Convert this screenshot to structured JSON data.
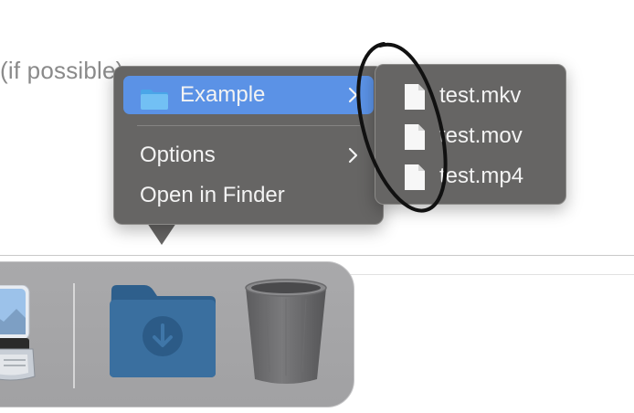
{
  "background": {
    "text": "(if possible)"
  },
  "context_menu": {
    "items": [
      {
        "label": "Example",
        "icon": "folder-icon",
        "has_submenu": true,
        "highlighted": true
      },
      {
        "label": "Options",
        "has_submenu": true
      },
      {
        "label": "Open in Finder"
      }
    ]
  },
  "submenu": {
    "items": [
      {
        "label": "test.mkv",
        "icon": "document-icon"
      },
      {
        "label": "test.mov",
        "icon": "document-icon"
      },
      {
        "label": "test.mp4",
        "icon": "document-icon"
      }
    ]
  },
  "dock": {
    "items": [
      {
        "icon": "preview-app-icon"
      },
      {
        "icon": "downloads-folder-icon"
      },
      {
        "icon": "trash-icon"
      }
    ]
  },
  "colors": {
    "menu_bg": "#666564",
    "highlight": "#5b92e6",
    "dock_bg": "#a9a9ab",
    "annotation": "#111111"
  }
}
